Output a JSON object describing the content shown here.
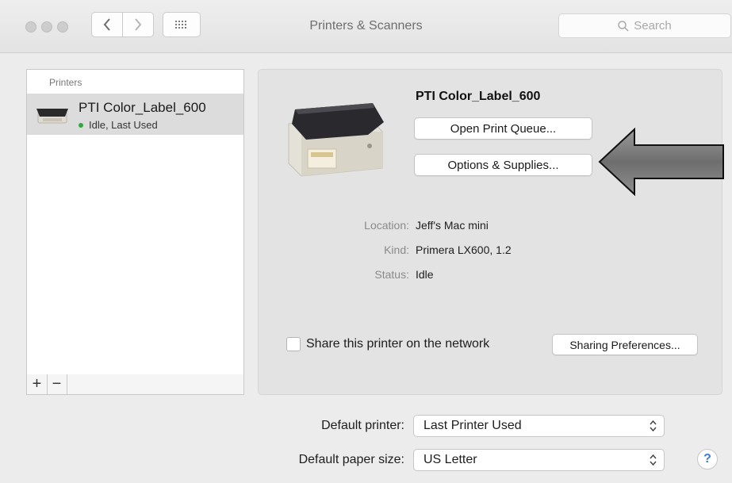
{
  "window": {
    "title": "Printers & Scanners",
    "search_placeholder": "Search"
  },
  "toolbar": {
    "back_icon": "chevron-left-icon",
    "forward_icon": "chevron-right-icon",
    "grid_icon": "grid-icon"
  },
  "printer_list": {
    "header": "Printers",
    "items": [
      {
        "name": "PTI Color_Label_600",
        "status": "Idle, Last Used",
        "status_color": "#2fa844"
      }
    ],
    "add_label": "+",
    "remove_label": "−"
  },
  "detail": {
    "printer_name": "PTI Color_Label_600",
    "open_queue_label": "Open Print Queue...",
    "options_label": "Options & Supplies...",
    "location_label": "Location:",
    "location_value": "Jeff's Mac mini",
    "kind_label": "Kind:",
    "kind_value": "Primera LX600, 1.2",
    "status_label": "Status:",
    "status_value": "Idle",
    "share_label": "Share this printer on the network",
    "share_checked": false,
    "sharing_prefs_label": "Sharing Preferences..."
  },
  "defaults": {
    "printer_label": "Default printer:",
    "printer_value": "Last Printer Used",
    "paper_label": "Default paper size:",
    "paper_value": "US Letter"
  },
  "help_label": "?"
}
